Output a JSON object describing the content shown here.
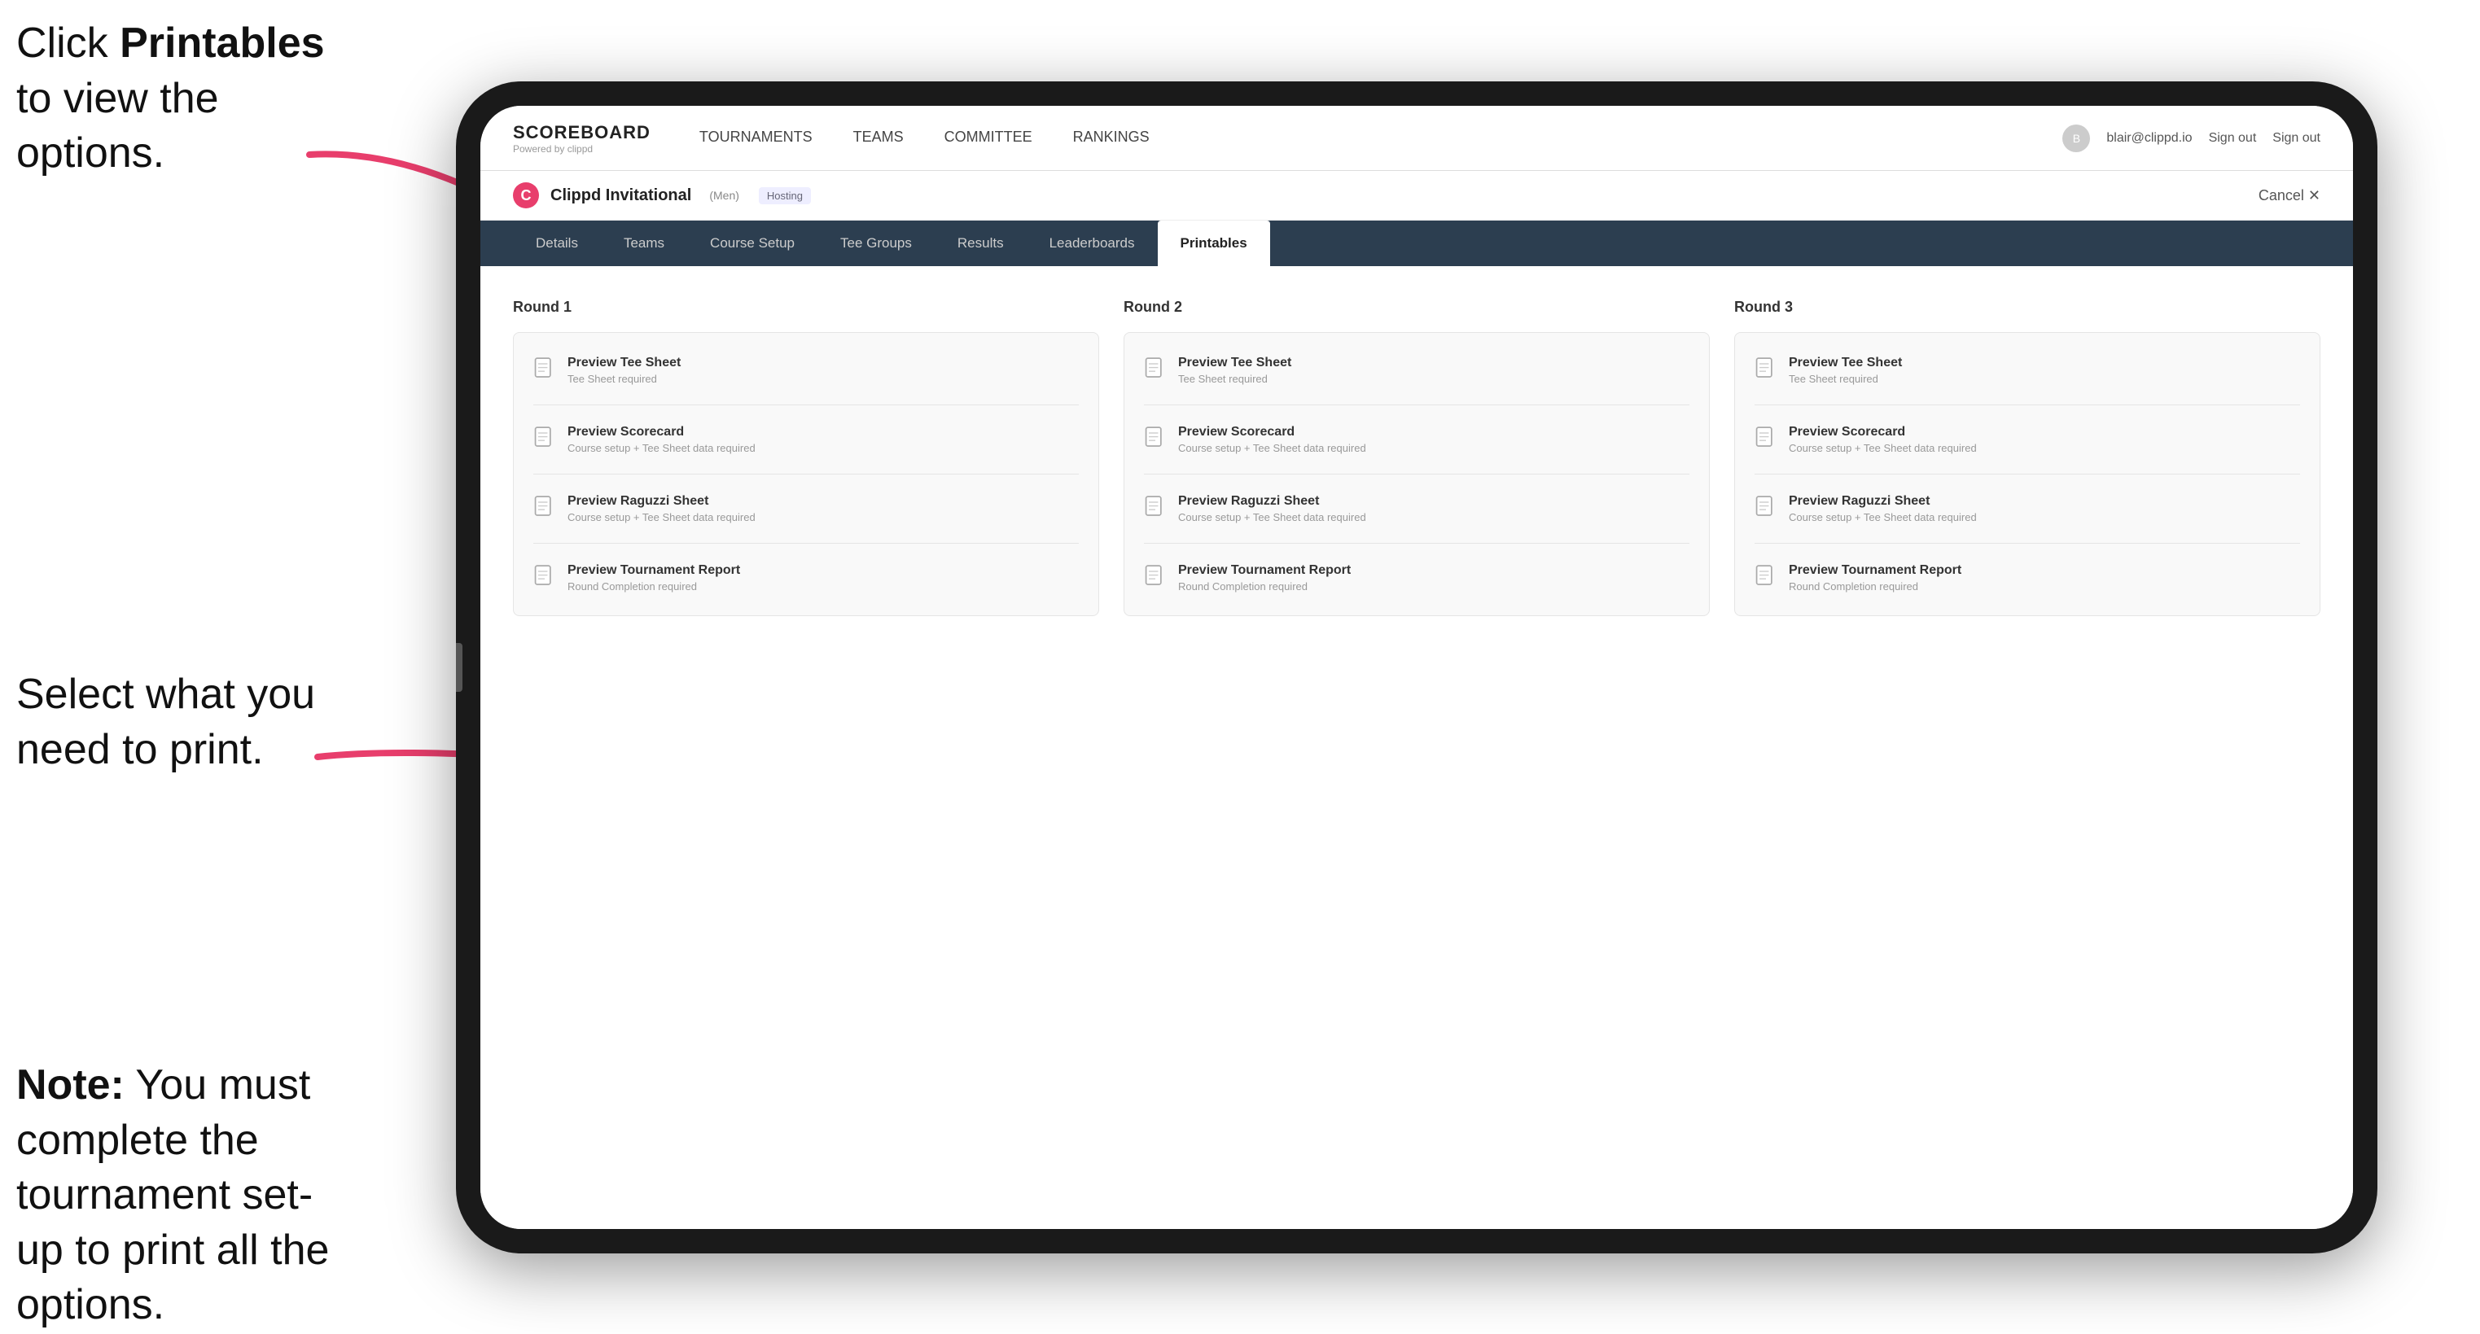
{
  "annotations": {
    "top_text_part1": "Click ",
    "top_text_bold": "Printables",
    "top_text_part2": " to view the options.",
    "middle_text": "Select what you need to print.",
    "bottom_text_bold": "Note:",
    "bottom_text_rest": " You must complete the tournament set-up to print all the options."
  },
  "nav": {
    "logo_title": "SCOREBOARD",
    "logo_sub": "Powered by clippd",
    "links": [
      "TOURNAMENTS",
      "TEAMS",
      "COMMITTEE",
      "RANKINGS"
    ],
    "user_email": "blair@clippd.io",
    "sign_out": "Sign out"
  },
  "tournament": {
    "name": "Clippd Invitational",
    "badge": "(Men)",
    "hosting": "Hosting",
    "cancel": "Cancel ✕"
  },
  "sub_tabs": [
    "Details",
    "Teams",
    "Course Setup",
    "Tee Groups",
    "Results",
    "Leaderboards",
    "Printables"
  ],
  "active_tab": "Printables",
  "rounds": [
    {
      "title": "Round 1",
      "items": [
        {
          "title": "Preview Tee Sheet",
          "sub": "Tee Sheet required"
        },
        {
          "title": "Preview Scorecard",
          "sub": "Course setup + Tee Sheet data required"
        },
        {
          "title": "Preview Raguzzi Sheet",
          "sub": "Course setup + Tee Sheet data required"
        },
        {
          "title": "Preview Tournament Report",
          "sub": "Round Completion required"
        }
      ]
    },
    {
      "title": "Round 2",
      "items": [
        {
          "title": "Preview Tee Sheet",
          "sub": "Tee Sheet required"
        },
        {
          "title": "Preview Scorecard",
          "sub": "Course setup + Tee Sheet data required"
        },
        {
          "title": "Preview Raguzzi Sheet",
          "sub": "Course setup + Tee Sheet data required"
        },
        {
          "title": "Preview Tournament Report",
          "sub": "Round Completion required"
        }
      ]
    },
    {
      "title": "Round 3",
      "items": [
        {
          "title": "Preview Tee Sheet",
          "sub": "Tee Sheet required"
        },
        {
          "title": "Preview Scorecard",
          "sub": "Course setup + Tee Sheet data required"
        },
        {
          "title": "Preview Raguzzi Sheet",
          "sub": "Course setup + Tee Sheet data required"
        },
        {
          "title": "Preview Tournament Report",
          "sub": "Round Completion required"
        }
      ]
    }
  ]
}
